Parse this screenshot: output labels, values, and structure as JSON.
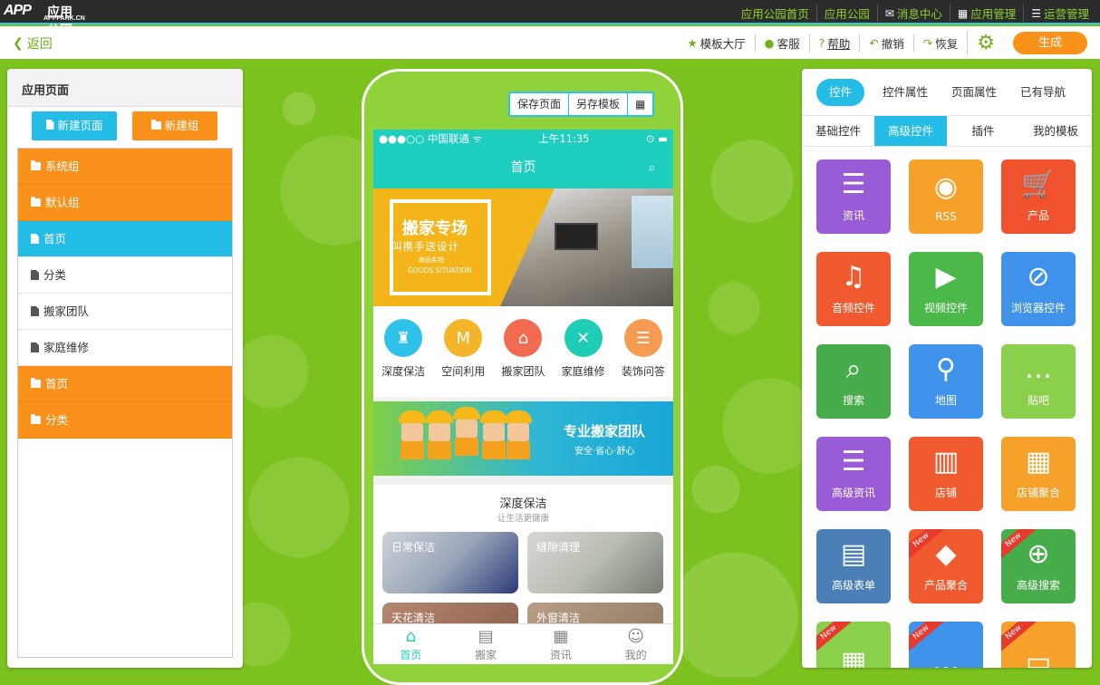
{
  "topbar": {
    "logo": "APP",
    "logo_zh": "应用公园",
    "logo_sub": "APPPARK.CN",
    "nav": [
      {
        "label": "应用公园首页",
        "icon": ""
      },
      {
        "label": "应用公园",
        "icon": ""
      },
      {
        "label": "消息中心",
        "icon": "envelope-icon"
      },
      {
        "label": "应用管理",
        "icon": "grid-icon"
      },
      {
        "label": "运营管理",
        "icon": "list-icon"
      }
    ]
  },
  "toolbar": {
    "back": "返回",
    "template_hall": "模板大厅",
    "service": "客服",
    "help": "帮助",
    "undo": "撤销",
    "redo": "恢复",
    "generate": "生成"
  },
  "left": {
    "title": "应用页面",
    "new_page": "新建页面",
    "new_group": "新建组",
    "rows": [
      {
        "label": "系统组",
        "type": "group"
      },
      {
        "label": "默认组",
        "type": "group-open"
      },
      {
        "label": "首页",
        "type": "page-active"
      },
      {
        "label": "分类",
        "type": "page"
      },
      {
        "label": "搬家团队",
        "type": "page"
      },
      {
        "label": "家庭维修",
        "type": "page"
      },
      {
        "label": "首页",
        "type": "group"
      },
      {
        "label": "分类",
        "type": "group"
      }
    ]
  },
  "phone": {
    "save_page": "保存页面",
    "save_template": "另存模板",
    "status_left": "●●●○○ 中国联通 ᯤ",
    "status_time": "上午11:35",
    "status_right": "⊙ ▬",
    "title": "首页",
    "banner": {
      "t1": "搬家专场",
      "t2": "叫携手送设计",
      "t3": "商品实拍",
      "t4": "GOODS SITUATION"
    },
    "icons": [
      {
        "label": "深度保洁",
        "color": "#2ec1ea",
        "glyph": "♜"
      },
      {
        "label": "空间利用",
        "color": "#f5b52a",
        "glyph": "M"
      },
      {
        "label": "搬家团队",
        "color": "#f26a4f",
        "glyph": "⌂"
      },
      {
        "label": "家庭维修",
        "color": "#1fcdb7",
        "glyph": "✕"
      },
      {
        "label": "装饰问答",
        "color": "#f79a52",
        "glyph": "☰"
      }
    ],
    "team": {
      "t1": "专业搬家团队",
      "t2": "安全·省心·舒心"
    },
    "clean": {
      "title": "深度保洁",
      "subtitle": "让生活更健康",
      "items": [
        "日常保洁",
        "缝隙清理",
        "天花清洁",
        "外窗清洁"
      ]
    },
    "tabs": [
      {
        "label": "首页",
        "glyph": "⌂"
      },
      {
        "label": "搬家",
        "glyph": "▤"
      },
      {
        "label": "资讯",
        "glyph": "▦"
      },
      {
        "label": "我的",
        "glyph": "☺"
      }
    ]
  },
  "right": {
    "tabs": [
      "控件",
      "控件属性",
      "页面属性",
      "已有导航"
    ],
    "subtabs": [
      "基础控件",
      "高级控件",
      "插件",
      "我的模板"
    ],
    "tiles": [
      {
        "label": "资讯",
        "color": "#9a5bd6",
        "glyph": "☰",
        "new": false
      },
      {
        "label": "RSS",
        "color": "#f5a12a",
        "glyph": "◉",
        "new": false
      },
      {
        "label": "产品",
        "color": "#f0522e",
        "glyph": "🛒",
        "new": false
      },
      {
        "label": "音频控件",
        "color": "#f05a2e",
        "glyph": "♫",
        "new": false
      },
      {
        "label": "视频控件",
        "color": "#4bb84a",
        "glyph": "▶",
        "new": false
      },
      {
        "label": "浏览器控件",
        "color": "#3f93ea",
        "glyph": "⊘",
        "new": false
      },
      {
        "label": "搜索",
        "color": "#47ad4a",
        "glyph": "⌕",
        "new": false
      },
      {
        "label": "地图",
        "color": "#3f93ea",
        "glyph": "⚲",
        "new": false
      },
      {
        "label": "贴吧",
        "color": "#8bd04a",
        "glyph": "…",
        "new": false
      },
      {
        "label": "高级资讯",
        "color": "#9a5bd6",
        "glyph": "☰",
        "new": false
      },
      {
        "label": "店铺",
        "color": "#f05a2e",
        "glyph": "▥",
        "new": false
      },
      {
        "label": "店铺聚合",
        "color": "#f5a12a",
        "glyph": "▦",
        "new": false
      },
      {
        "label": "高级表单",
        "color": "#4a7fb8",
        "glyph": "▤",
        "new": false
      },
      {
        "label": "产品聚合",
        "color": "#f05a2e",
        "glyph": "◆",
        "new": true
      },
      {
        "label": "高级搜索",
        "color": "#47ad4a",
        "glyph": "⊕",
        "new": true
      },
      {
        "label": "",
        "color": "#8bd04a",
        "glyph": "▦",
        "new": true
      },
      {
        "label": "",
        "color": "#3f93ea",
        "glyph": "…",
        "new": true
      },
      {
        "label": "",
        "color": "#f5a12a",
        "glyph": "▭",
        "new": true
      }
    ],
    "new_label": "New"
  }
}
